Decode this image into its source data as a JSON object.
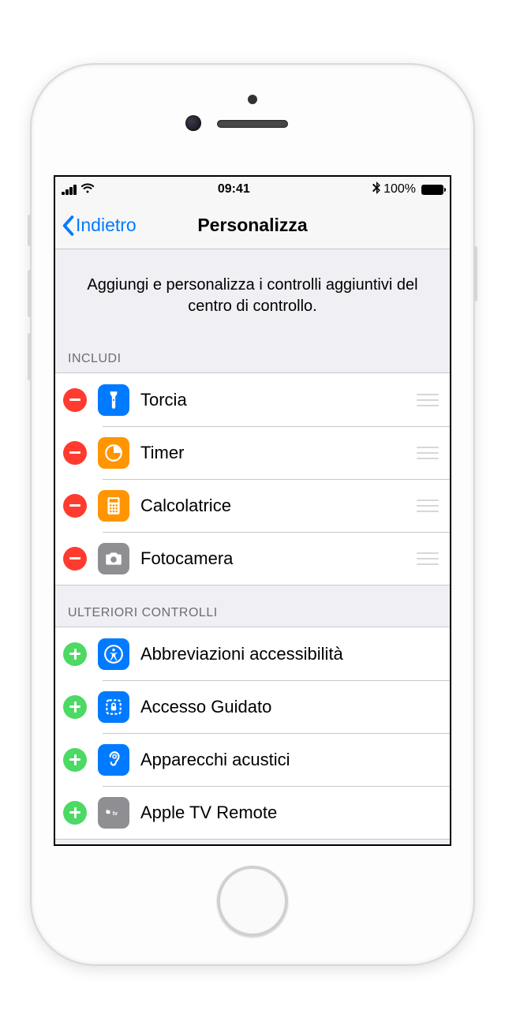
{
  "status": {
    "time": "09:41",
    "battery_pct": "100%"
  },
  "nav": {
    "back_label": "Indietro",
    "title": "Personalizza"
  },
  "intro": "Aggiungi e personalizza i controlli aggiuntivi del centro di controllo.",
  "sections": {
    "include_header": "INCLUDI",
    "more_header": "ULTERIORI CONTROLLI"
  },
  "include": [
    {
      "label": "Torcia",
      "icon": "flashlight",
      "icon_bg": "blue"
    },
    {
      "label": "Timer",
      "icon": "timer",
      "icon_bg": "orange"
    },
    {
      "label": "Calcolatrice",
      "icon": "calculator",
      "icon_bg": "orange"
    },
    {
      "label": "Fotocamera",
      "icon": "camera",
      "icon_bg": "gray"
    }
  ],
  "more": [
    {
      "label": "Abbreviazioni accessibilità",
      "icon": "accessibility",
      "icon_bg": "blue"
    },
    {
      "label": "Accesso Guidato",
      "icon": "guided",
      "icon_bg": "blue"
    },
    {
      "label": "Apparecchi acustici",
      "icon": "hearing",
      "icon_bg": "blue"
    },
    {
      "label": "Apple TV Remote",
      "icon": "appletv",
      "icon_bg": "gray"
    }
  ]
}
